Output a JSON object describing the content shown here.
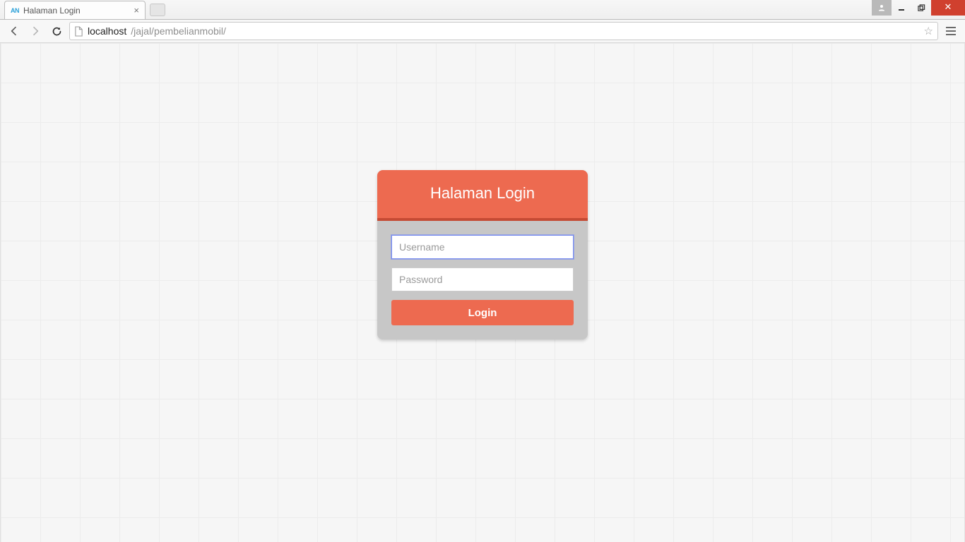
{
  "browser": {
    "tab": {
      "favicon_text": "AN",
      "title": "Halaman Login"
    },
    "url": {
      "host": "localhost",
      "path": "/jajal/pembelianmobil/"
    }
  },
  "login": {
    "header": "Halaman Login",
    "username_placeholder": "Username",
    "username_value": "",
    "password_placeholder": "Password",
    "password_value": "",
    "button_label": "Login"
  },
  "colors": {
    "accent": "#ed6a50",
    "accent_dark": "#c54a34",
    "card_bg": "#c7c7c7"
  }
}
